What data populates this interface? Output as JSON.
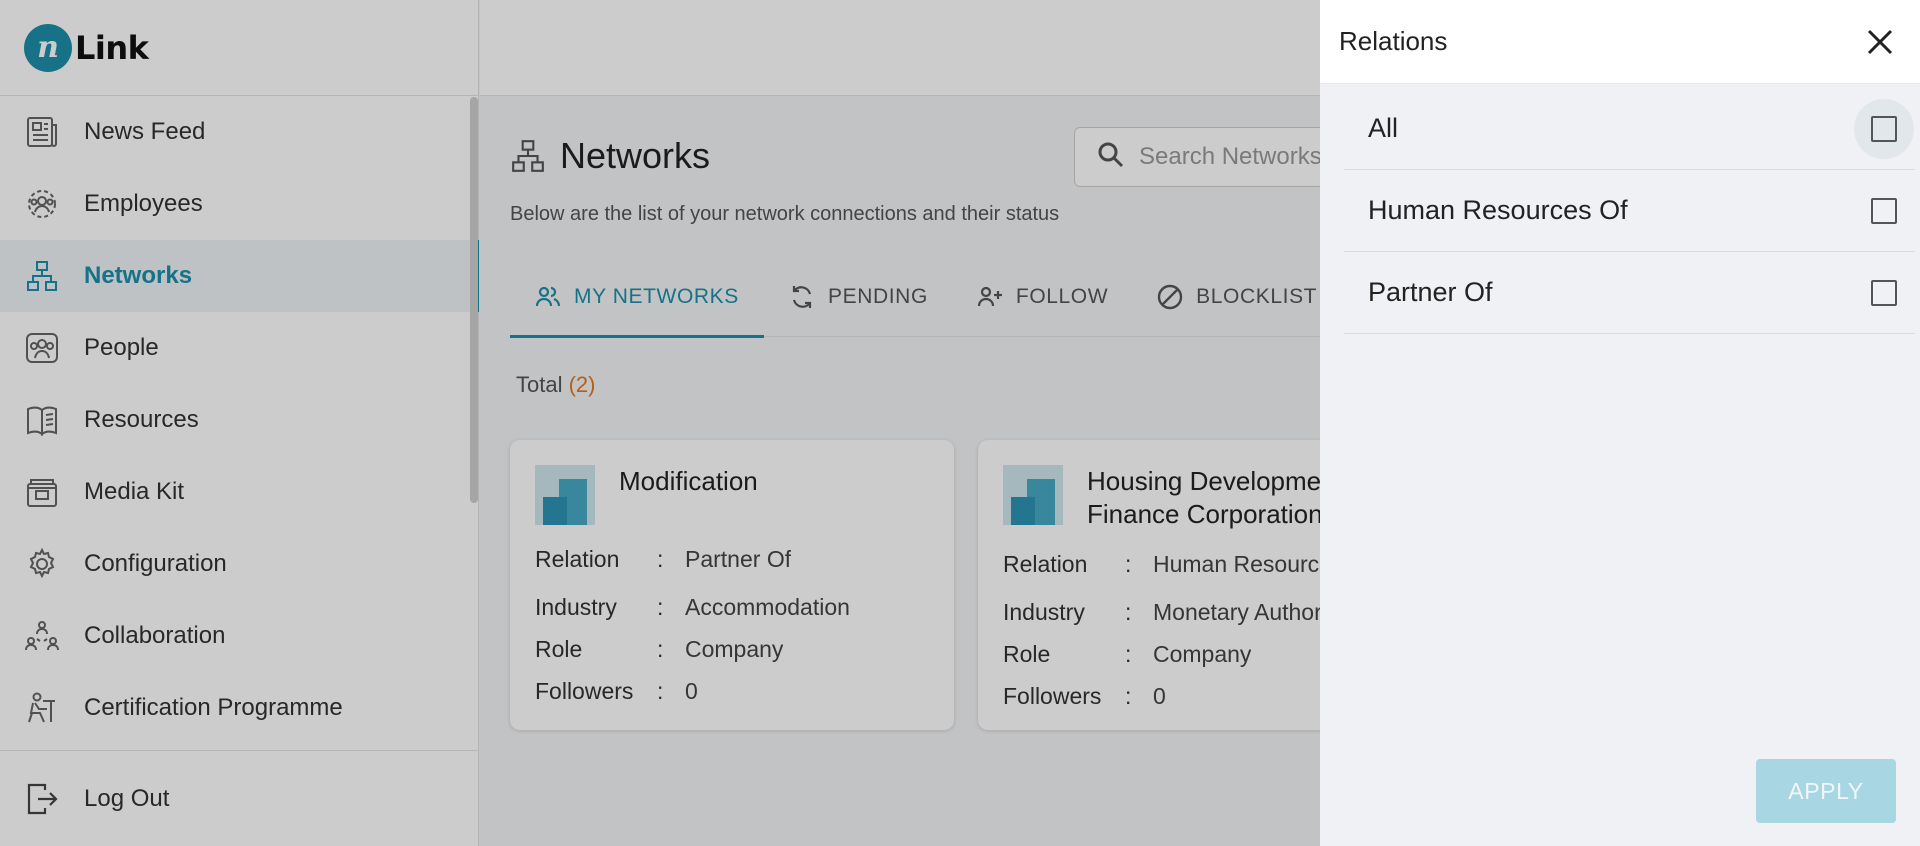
{
  "app": {
    "logo_letter": "n",
    "logo_text": "Link"
  },
  "sidebar": {
    "items": [
      {
        "label": "News Feed",
        "icon": "newspaper-icon"
      },
      {
        "label": "Employees",
        "icon": "employees-icon"
      },
      {
        "label": "Networks",
        "icon": "network-icon",
        "active": true
      },
      {
        "label": "People",
        "icon": "people-icon"
      },
      {
        "label": "Resources",
        "icon": "book-icon"
      },
      {
        "label": "Media Kit",
        "icon": "media-kit-icon"
      },
      {
        "label": "Configuration",
        "icon": "gear-icon"
      },
      {
        "label": "Collaboration",
        "icon": "collaboration-icon"
      },
      {
        "label": "Certification Programme",
        "icon": "certification-icon"
      }
    ],
    "logout_label": "Log Out"
  },
  "main": {
    "title": "Networks",
    "subtitle": "Below are the list of your network connections and their status",
    "search_placeholder": "Search Networks",
    "tabs": [
      {
        "label": "MY NETWORKS",
        "icon": "users-icon",
        "active": true
      },
      {
        "label": "PENDING",
        "icon": "sync-icon"
      },
      {
        "label": "FOLLOW",
        "icon": "add-user-icon"
      },
      {
        "label": "BLOCKLIST",
        "icon": "block-icon"
      }
    ],
    "total_label": "Total",
    "total_count": "(2)",
    "field_labels": {
      "relation": "Relation",
      "industry": "Industry",
      "role": "Role",
      "followers": "Followers",
      "separator": ":"
    },
    "cards": [
      {
        "name": "Modification",
        "relation": "Partner Of",
        "industry": "Accommodation",
        "role": "Company",
        "followers": "0"
      },
      {
        "name": "Housing Development Finance Corporation",
        "relation": "Human Resources Of",
        "industry": "Monetary Authorities",
        "role": "Company",
        "followers": "0"
      }
    ]
  },
  "drawer": {
    "title": "Relations",
    "options": [
      {
        "label": "All",
        "checked": false
      },
      {
        "label": "Human Resources Of",
        "checked": false
      },
      {
        "label": "Partner Of",
        "checked": false
      }
    ],
    "apply_label": "APPLY"
  },
  "colors": {
    "accent": "#1b8fab",
    "count": "#e07a1f",
    "apply_disabled": "#a9d6e3"
  }
}
